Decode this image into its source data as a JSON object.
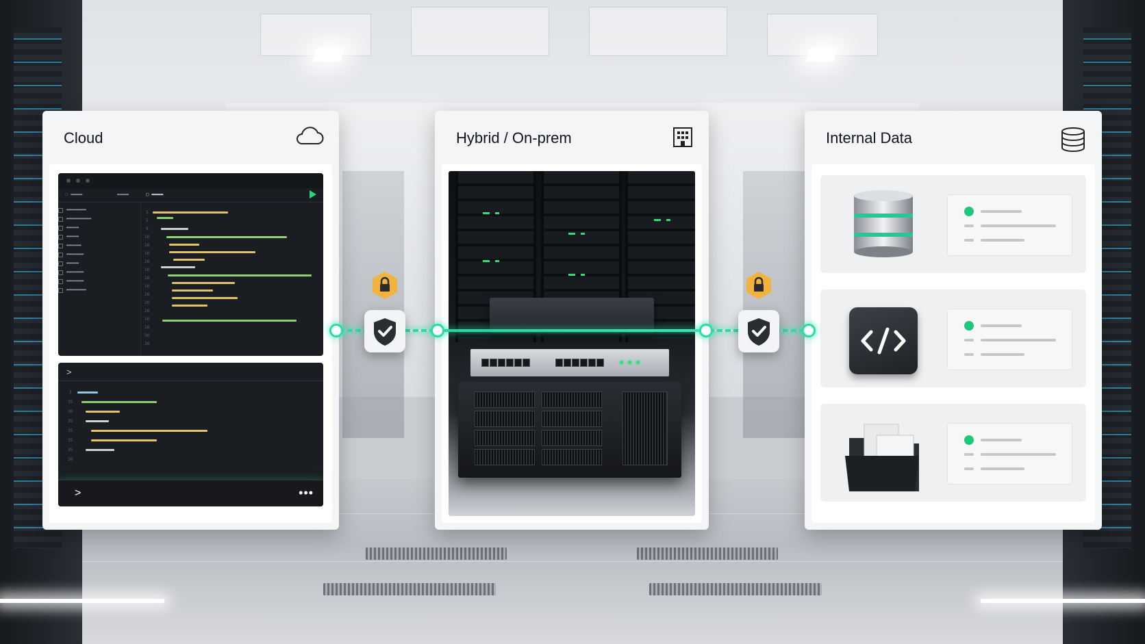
{
  "panels": [
    {
      "title": "Cloud",
      "icon": "cloud-icon"
    },
    {
      "title": "Hybrid / On-prem",
      "icon": "building-icon"
    },
    {
      "title": "Internal Data",
      "icon": "database-icon"
    }
  ],
  "terminal": {
    "prompt": ">",
    "run_prompt": ">",
    "more": "•••"
  },
  "internal_items": [
    {
      "icon": "database-stack-icon",
      "status": "green"
    },
    {
      "icon": "code-icon",
      "status": "green"
    },
    {
      "icon": "folder-icon",
      "status": "green"
    }
  ],
  "security": {
    "shield_icon": "shield-check-icon",
    "lock_icon": "lock-icon"
  },
  "colors": {
    "accent": "#2bdcaa",
    "status": "#1fc77a",
    "lock": "#f2b33d"
  }
}
